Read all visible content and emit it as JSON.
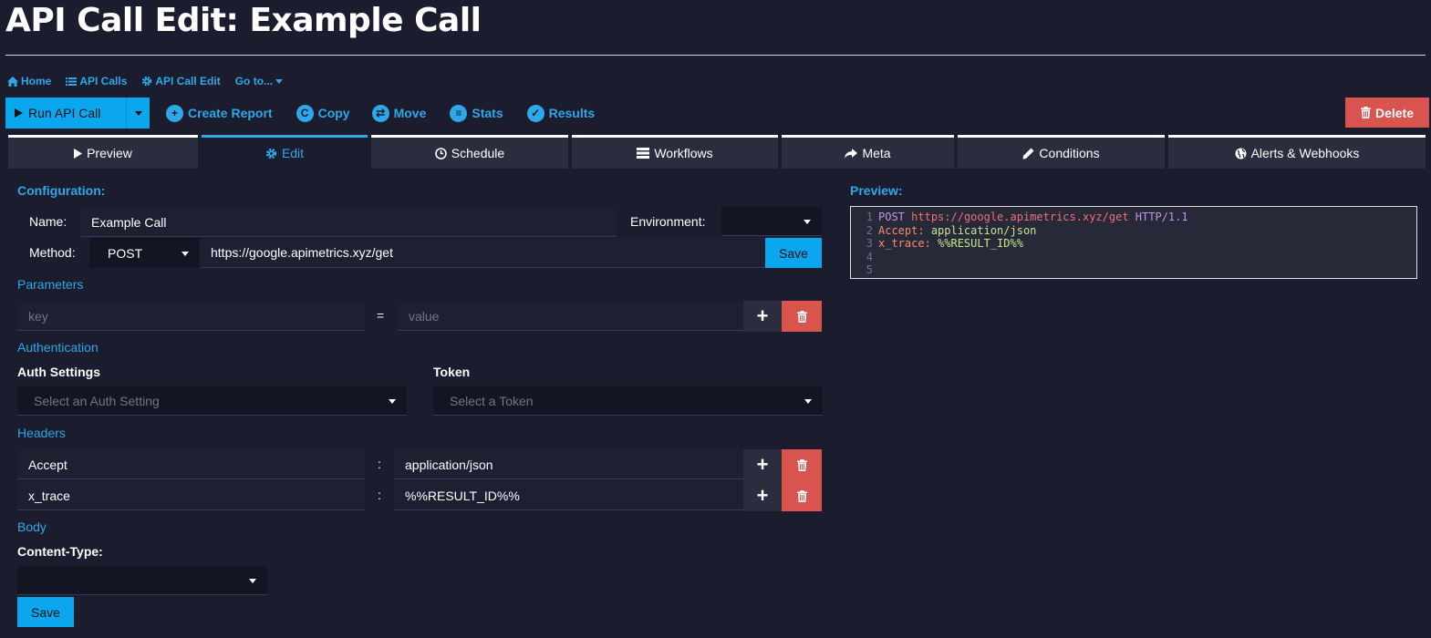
{
  "page_title": "API Call Edit: Example Call",
  "breadcrumbs": [
    {
      "label": "Home",
      "icon": "home-icon"
    },
    {
      "label": "API Calls",
      "icon": "list-icon"
    },
    {
      "label": "API Call Edit",
      "icon": "gear-icon"
    },
    {
      "label": "Go to...",
      "icon": "caret-down-icon"
    }
  ],
  "toolbar": {
    "run_label": "Run API Call",
    "create_report": "Create Report",
    "copy": "Copy",
    "move": "Move",
    "stats": "Stats",
    "results": "Results",
    "delete": "Delete"
  },
  "tabs": [
    {
      "label": "Preview",
      "icon": "play-icon"
    },
    {
      "label": "Edit",
      "icon": "gear-icon"
    },
    {
      "label": "Schedule",
      "icon": "clock-icon"
    },
    {
      "label": "Workflows",
      "icon": "server-icon"
    },
    {
      "label": "Meta",
      "icon": "share-icon"
    },
    {
      "label": "Conditions",
      "icon": "pencil-icon"
    },
    {
      "label": "Alerts & Webhooks",
      "icon": "globe-icon"
    }
  ],
  "config": {
    "heading": "Configuration:",
    "name_label": "Name:",
    "name_value": "Example Call",
    "env_label": "Environment:",
    "env_value": "",
    "method_label": "Method:",
    "method_value": "POST",
    "url_value": "https://google.apimetrics.xyz/get",
    "save_label": "Save"
  },
  "parameters": {
    "heading": "Parameters",
    "key_placeholder": "key",
    "eq": "=",
    "value_placeholder": "value"
  },
  "auth": {
    "heading": "Authentication",
    "settings_label": "Auth Settings",
    "settings_placeholder": "Select an Auth Setting",
    "token_label": "Token",
    "token_placeholder": "Select a Token"
  },
  "headers": {
    "heading": "Headers",
    "sep": ":",
    "rows": [
      {
        "key": "Accept",
        "value": "application/json"
      },
      {
        "key": "x_trace",
        "value": "%%RESULT_ID%%"
      }
    ]
  },
  "body": {
    "heading": "Body",
    "content_type_label": "Content-Type:",
    "content_type_value": "",
    "save_label": "Save"
  },
  "preview": {
    "heading": "Preview:",
    "line_numbers": [
      "1",
      "2",
      "3",
      "4",
      "5"
    ],
    "line1": {
      "method": "POST",
      "url": "https://google.apimetrics.xyz/get",
      "proto": "HTTP/1.1"
    },
    "line2": {
      "key": "Accept:",
      "value": "application/json"
    },
    "line3": {
      "key": "x_trace:",
      "value": "%%RESULT_ID%%"
    }
  },
  "colors": {
    "background": "#1b1c2e",
    "accent": "#2ea8e8",
    "primary_button": "#0aa6ee",
    "danger": "#d9534f",
    "tab_bg": "#2b2c3e"
  }
}
